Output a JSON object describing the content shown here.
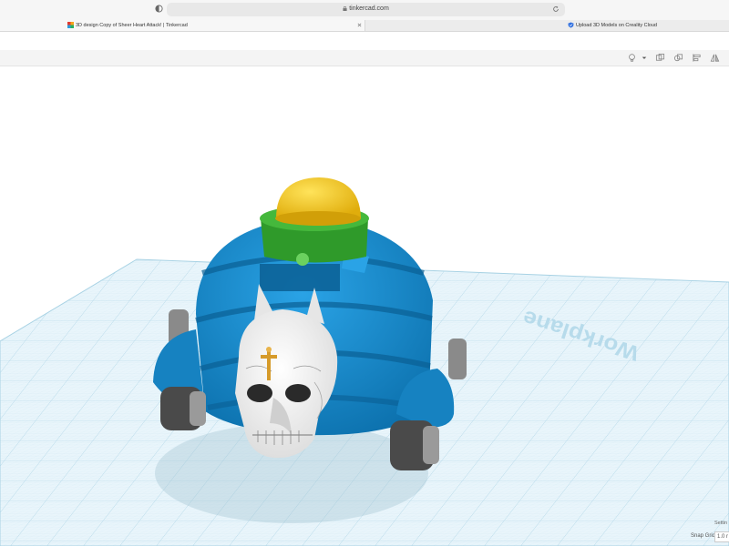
{
  "browser": {
    "url": "tinkercad.com",
    "tabs": [
      {
        "label": "3D design Copy of Sheer Heart Attack! | Tinkercad"
      },
      {
        "label": "Upload 3D Models on Creality Cloud"
      }
    ]
  },
  "workplane": {
    "label": "Workplane"
  },
  "status": {
    "settings_label": "Settin",
    "snap_grid_label": "Snap Grid",
    "snap_grid_value": "1.0 r"
  },
  "toolbar": {
    "icons": [
      "lightbulb-icon",
      "dropdown-caret-icon",
      "group-icon",
      "ungroup-icon",
      "align-icon",
      "mirror-icon"
    ]
  },
  "model": {
    "parts": [
      "yellow-dome",
      "green-ring",
      "blue-shell",
      "skull",
      "wheels"
    ],
    "colors": {
      "shell": "#1a8fd1",
      "shell_dark": "#0c6fa7",
      "ring": "#35a92e",
      "dome": "#f0c419",
      "skull": "#f2f2f2",
      "wheel": "#4a4a4a",
      "cross": "#d69b2b"
    }
  }
}
